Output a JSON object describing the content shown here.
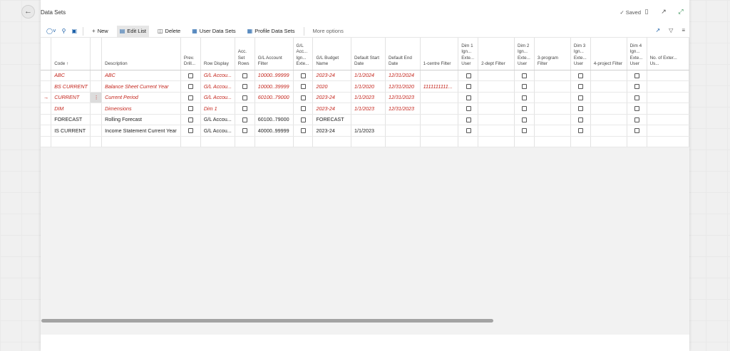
{
  "page": {
    "title": "Data Sets",
    "saved_label": "Saved"
  },
  "icons": {
    "back": "arrow-left-icon",
    "saved": "check-icon",
    "bookmark": "bookmark-icon",
    "open_new": "open-in-new-window-icon",
    "collapse": "collapse-icon",
    "share": "share-icon",
    "filter": "filter-icon",
    "list": "list-options-icon"
  },
  "toolbar": {
    "new_label": "New",
    "edit_list_label": "Edit List",
    "delete_label": "Delete",
    "user_data_sets_label": "User Data Sets",
    "profile_data_sets_label": "Profile Data Sets",
    "more_options_label": "More options"
  },
  "colors": {
    "modified_row": "#c4261d",
    "accent": "#1a5fa8"
  },
  "columns": [
    "Code ↑",
    "Description",
    "Prev. Drill...",
    "Row Display",
    "Acc. Set Rows",
    "G/L Account Filter",
    "G/L Acc... Ign... Exte...",
    "G/L Budget Name",
    "Default Start Date",
    "Default End Date",
    "1-centre Filter",
    "Dim 1 Ign... Exte... User",
    "2-dept Filter",
    "Dim 2 Ign... Exte... User",
    "3-program Filter",
    "Dim 3 Ign... Exte... User",
    "4-project Filter",
    "Dim 4 Ign... Exte... User",
    "No. of Exter... Us..."
  ],
  "rows": [
    {
      "code": "ABC",
      "description": "ABC",
      "row_display": "G/L Accou...",
      "gl_filter": "10000..99999",
      "budget": "2023-24",
      "start": "1/1/2024",
      "end": "12/31/2024",
      "centre": "",
      "modified": true,
      "current": false
    },
    {
      "code": "BS CURRENT",
      "description": "Balance Sheet Current Year",
      "row_display": "G/L Accou...",
      "gl_filter": "10000..39999",
      "budget": "2020",
      "start": "1/1/2020",
      "end": "12/31/2020",
      "centre": "1111111111...",
      "modified": true,
      "current": false
    },
    {
      "code": "CURRENT",
      "description": "Current Period",
      "row_display": "G/L Accou...",
      "gl_filter": "60100..79000",
      "budget": "2023-24",
      "start": "1/1/2023",
      "end": "12/31/2023",
      "centre": "",
      "modified": true,
      "current": true
    },
    {
      "code": "DIM",
      "description": "Dimensions",
      "row_display": "Dim 1",
      "gl_filter": "",
      "budget": "2023-24",
      "start": "1/1/2023",
      "end": "12/31/2023",
      "centre": "",
      "modified": true,
      "current": false
    },
    {
      "code": "FORECAST",
      "description": "Rolling Forecast",
      "row_display": "G/L Accou...",
      "gl_filter": "60100..79000",
      "budget": "FORECAST",
      "start": "",
      "end": "",
      "centre": "",
      "modified": false,
      "current": false
    },
    {
      "code": "IS CURRENT",
      "description": "Income Statement Current Year",
      "row_display": "G/L Accou...",
      "gl_filter": "40000..99999",
      "budget": "2023-24",
      "start": "1/1/2023",
      "end": "",
      "centre": "",
      "modified": false,
      "current": false
    }
  ]
}
